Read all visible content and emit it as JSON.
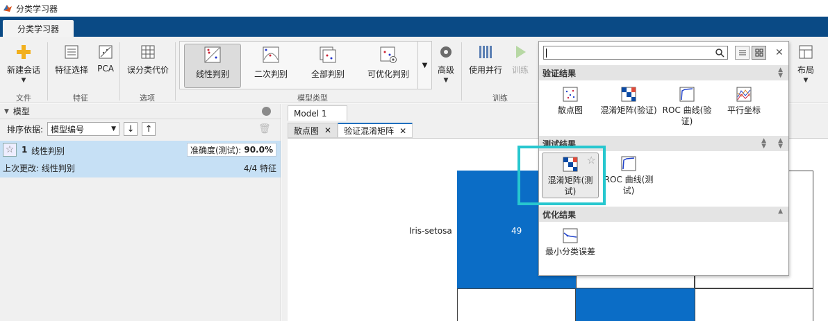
{
  "window": {
    "title": "分类学习器"
  },
  "app_tab": "分类学习器",
  "toolstrip": {
    "new_session": "新建会话",
    "feature_select": "特征选择",
    "pca": "PCA",
    "misclass_cost": "误分类代价",
    "sections": {
      "file": "文件",
      "feature": "特征",
      "options": "选项",
      "model_type": "模型类型",
      "train": "训练"
    },
    "models": [
      "线性判别",
      "二次判别",
      "全部判别",
      "可优化判别"
    ],
    "advanced": "高级",
    "use_parallel": "使用并行",
    "train_label": "训练",
    "layout": "布局"
  },
  "left": {
    "header": "模型",
    "sort_by": "排序依据:",
    "sort_value": "模型编号",
    "model": {
      "number": "1",
      "name": "线性判别",
      "acc_label": "准确度(测试):",
      "acc_value": "90.0%",
      "last_change": "上次更改: 线性判别",
      "features": "4/4 特征"
    }
  },
  "right": {
    "doc_tab": "Model 1",
    "plot_tabs": [
      "散点图",
      "验证混淆矩阵"
    ],
    "cm": {
      "row_label": "Iris-setosa",
      "value": "49"
    }
  },
  "gallery": {
    "sections": {
      "validation": "验证结果",
      "test": "测试结果",
      "optimize": "优化结果"
    },
    "validation_items": [
      "散点图",
      "混淆矩阵(验证)",
      "ROC 曲线(验证)",
      "平行坐标"
    ],
    "test_items": [
      "混淆矩阵(测试)",
      "ROC 曲线(测试)"
    ],
    "optimize_items": [
      "最小分类误差"
    ]
  },
  "colors": {
    "accent": "#0a4a85",
    "cm_blue": "#0b6dc6",
    "highlight": "#27c7cf"
  }
}
